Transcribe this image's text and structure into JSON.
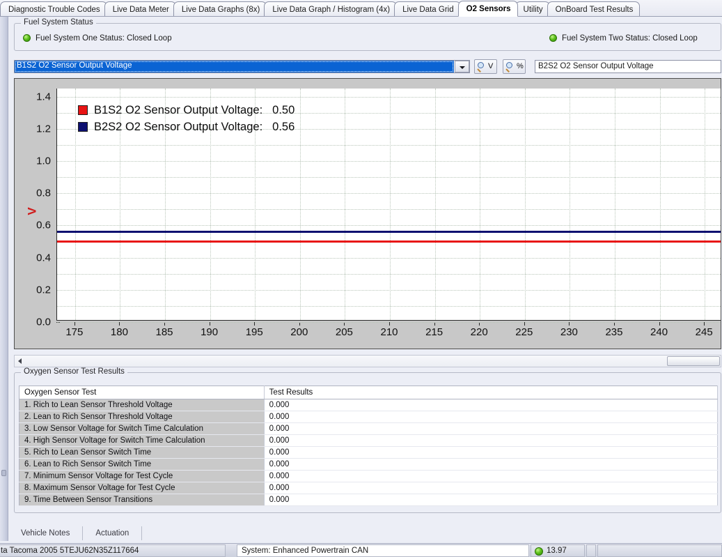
{
  "tabs": [
    {
      "label": "Diagnostic Trouble Codes",
      "active": false
    },
    {
      "label": "Live Data Meter",
      "active": false
    },
    {
      "label": "Live Data Graphs (8x)",
      "active": false
    },
    {
      "label": "Live Data Graph / Histogram (4x)",
      "active": false
    },
    {
      "label": "Live Data Grid",
      "active": false
    },
    {
      "label": "O2 Sensors",
      "active": true
    },
    {
      "label": "Utility",
      "active": false
    },
    {
      "label": "OnBoard Test Results",
      "active": false
    }
  ],
  "fuel_system": {
    "group_title": "Fuel System Status",
    "one_label": "Fuel System One Status:  Closed Loop",
    "two_label": "Fuel System Two Status:  Closed Loop",
    "led_color": "#5ec21c"
  },
  "selector": {
    "combo_value": "B1S2 O2 Sensor Output Voltage",
    "volt_button_label": "V",
    "pct_button_label": "%",
    "right_field_value": "B2S2 O2 Sensor Output Voltage"
  },
  "chart_data": {
    "type": "line",
    "title": "",
    "xlabel": "",
    "ylabel": "V",
    "xlim": [
      173,
      247
    ],
    "ylim": [
      0.0,
      1.45
    ],
    "yticks": [
      "0.0",
      "0.2",
      "0.4",
      "0.6",
      "0.8",
      "1.0",
      "1.2",
      "1.4"
    ],
    "ytick_values": [
      0.0,
      0.2,
      0.4,
      0.6,
      0.8,
      1.0,
      1.2,
      1.4
    ],
    "xticks": [
      "175",
      "180",
      "185",
      "190",
      "195",
      "200",
      "205",
      "210",
      "215",
      "220",
      "225",
      "230",
      "235",
      "240",
      "245"
    ],
    "xtick_values": [
      175,
      180,
      185,
      190,
      195,
      200,
      205,
      210,
      215,
      220,
      225,
      230,
      235,
      240,
      245
    ],
    "grid": true,
    "legend_position": "inside-top-left",
    "series": [
      {
        "name": "B1S2 O2 Sensor Output Voltage",
        "color": "#e81414",
        "current_value": "0.50",
        "constant_value": 0.5,
        "values": [
          0.5,
          0.5,
          0.5,
          0.5,
          0.5,
          0.5,
          0.5,
          0.5,
          0.5,
          0.5,
          0.5,
          0.5,
          0.5,
          0.5,
          0.5
        ]
      },
      {
        "name": "B2S2 O2 Sensor Output Voltage",
        "color": "#0d1070",
        "current_value": "0.56",
        "constant_value": 0.56,
        "values": [
          0.56,
          0.56,
          0.56,
          0.56,
          0.56,
          0.56,
          0.56,
          0.56,
          0.56,
          0.56,
          0.56,
          0.56,
          0.56,
          0.56,
          0.56
        ]
      }
    ]
  },
  "legend": [
    {
      "label": "B1S2 O2 Sensor Output Voltage:",
      "value": "0.50",
      "color": "#e81414"
    },
    {
      "label": "B2S2 O2 Sensor Output Voltage:",
      "value": "0.56",
      "color": "#0d1070"
    }
  ],
  "results": {
    "group_title": "Oxygen Sensor Test Results",
    "columns": [
      "Oxygen Sensor Test",
      "Test Results"
    ],
    "rows": [
      {
        "test": "1. Rich to Lean Sensor Threshold Voltage",
        "result": "0.000"
      },
      {
        "test": "2. Lean to Rich Sensor Threshold Voltage",
        "result": "0.000"
      },
      {
        "test": "3. Low Sensor Voltage for Switch Time Calculation",
        "result": "0.000"
      },
      {
        "test": "4. High Sensor Voltage for Switch Time Calculation",
        "result": "0.000"
      },
      {
        "test": "5. Rich to Lean Sensor Switch Time",
        "result": "0.000"
      },
      {
        "test": "6. Lean to Rich Sensor Switch Time",
        "result": "0.000"
      },
      {
        "test": "7. Minimum Sensor Voltage for Test Cycle",
        "result": "0.000"
      },
      {
        "test": "8. Maximum Sensor Voltage for Test Cycle",
        "result": "0.000"
      },
      {
        "test": "9. Time Between Sensor Transitions",
        "result": "0.000"
      }
    ]
  },
  "bottom_tabs": [
    {
      "label": "Vehicle Notes"
    },
    {
      "label": "Actuation"
    }
  ],
  "statusbar": {
    "vehicle": "ta  Tacoma  2005  5TEJU62N35Z117664",
    "system": "System: Enhanced Powertrain CAN",
    "voltage": "13.97",
    "voltage_led_color": "#5ec21c"
  }
}
